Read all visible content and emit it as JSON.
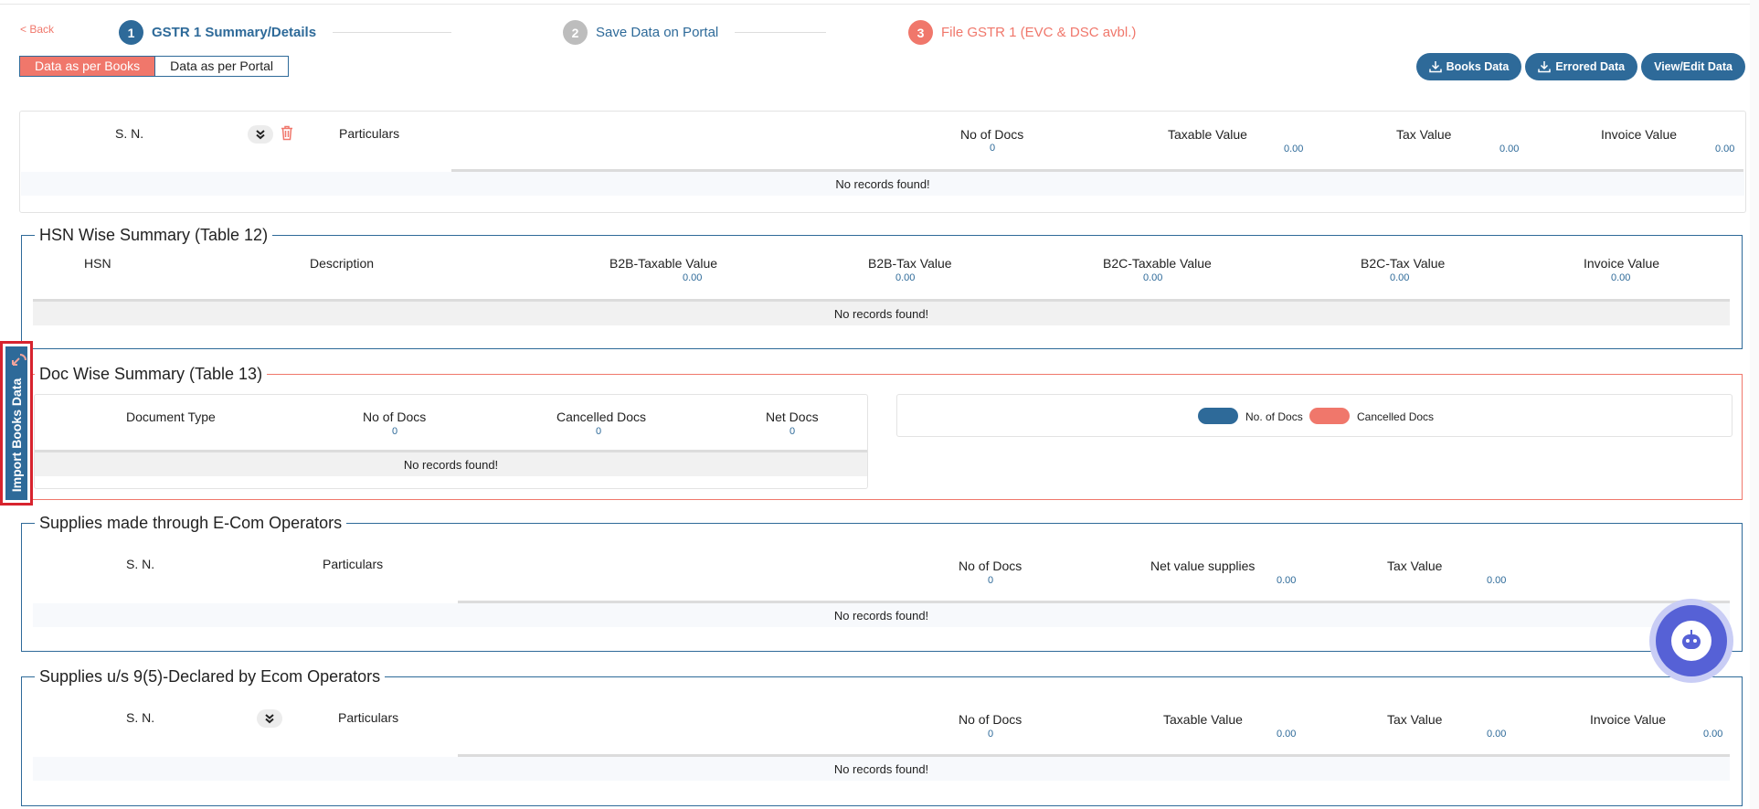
{
  "nav": {
    "back": "< Back"
  },
  "steps": [
    {
      "num": "1",
      "label": "GSTR 1 Summary/Details"
    },
    {
      "num": "2",
      "label": "Save Data on Portal"
    },
    {
      "num": "3",
      "label": "File GSTR 1 (EVC & DSC avbl.)"
    }
  ],
  "toggle": {
    "books": "Data as per Books",
    "portal": "Data as per Portal"
  },
  "actions": {
    "books_data": "Books Data",
    "errored_data": "Errored Data",
    "view_edit": "View/Edit Data"
  },
  "side_tab": {
    "label": "Import Books Data"
  },
  "empty_text": "No records found!",
  "summary_table": {
    "headers": {
      "sn": "S. N.",
      "particulars": "Particulars",
      "docs": "No of Docs",
      "taxable": "Taxable Value",
      "tax": "Tax Value",
      "invoice": "Invoice Value"
    },
    "totals": {
      "docs": "0",
      "taxable": "0.00",
      "tax": "0.00",
      "invoice": "0.00"
    }
  },
  "hsn": {
    "title": "HSN Wise Summary (Table 12)",
    "headers": {
      "hsn": "HSN",
      "description": "Description",
      "b2b_taxable": "B2B-Taxable Value",
      "b2b_tax": "B2B-Tax Value",
      "b2c_taxable": "B2C-Taxable Value",
      "b2c_tax": "B2C-Tax Value",
      "invoice": "Invoice Value"
    },
    "totals": {
      "b2b_taxable": "0.00",
      "b2b_tax": "0.00",
      "b2c_taxable": "0.00",
      "b2c_tax": "0.00",
      "invoice": "0.00"
    }
  },
  "doc": {
    "title": "Doc Wise Summary (Table 13)",
    "headers": {
      "type": "Document Type",
      "docs": "No of Docs",
      "cancelled": "Cancelled Docs",
      "net": "Net Docs"
    },
    "totals": {
      "docs": "0",
      "cancelled": "0",
      "net": "0"
    },
    "legend": [
      {
        "label": "No. of Docs",
        "color": "#2e6a99"
      },
      {
        "label": "Cancelled Docs",
        "color": "#f0776b"
      }
    ]
  },
  "ecom": {
    "title": "Supplies made through E-Com Operators",
    "headers": {
      "sn": "S. N.",
      "particulars": "Particulars",
      "docs": "No of Docs",
      "net": "Net value supplies",
      "tax": "Tax Value"
    },
    "totals": {
      "docs": "0",
      "net": "0.00",
      "tax": "0.00"
    }
  },
  "ecom95": {
    "title": "Supplies u/s 9(5)-Declared by Ecom Operators",
    "headers": {
      "sn": "S. N.",
      "particulars": "Particulars",
      "docs": "No of Docs",
      "taxable": "Taxable Value",
      "tax": "Tax Value",
      "invoice": "Invoice Value"
    },
    "totals": {
      "docs": "0",
      "taxable": "0.00",
      "tax": "0.00",
      "invoice": "0.00"
    }
  }
}
